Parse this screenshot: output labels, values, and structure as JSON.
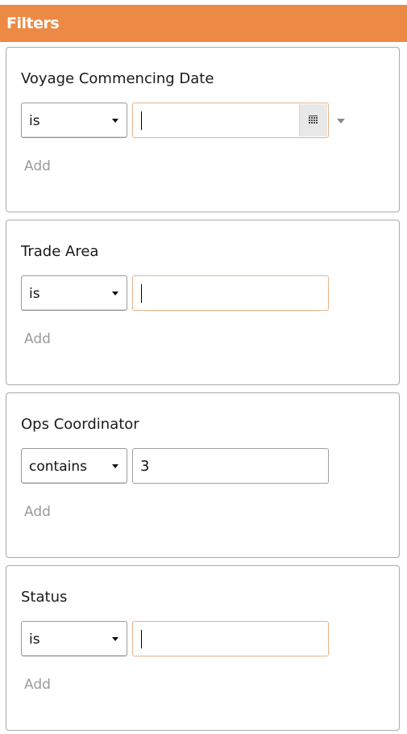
{
  "panel": {
    "title": "Filters"
  },
  "filters": [
    {
      "label": "Voyage Commencing Date",
      "operator": "is",
      "value": "",
      "add_label": "Add",
      "has_date_picker": true
    },
    {
      "label": "Trade Area",
      "operator": "is",
      "value": "",
      "add_label": "Add",
      "has_date_picker": false
    },
    {
      "label": "Ops Coordinator",
      "operator": "contains",
      "value": "3",
      "add_label": "Add",
      "has_date_picker": false
    },
    {
      "label": "Status",
      "operator": "is",
      "value": "",
      "add_label": "Add",
      "has_date_picker": false
    }
  ],
  "icons": {
    "dropdown": "chevron-down-icon",
    "calendar": "calendar-icon"
  },
  "colors": {
    "header_bg": "#ec8a45",
    "header_text": "#ffffff",
    "focus_border": "#e5b38b",
    "add_text": "#9b9b9b"
  }
}
